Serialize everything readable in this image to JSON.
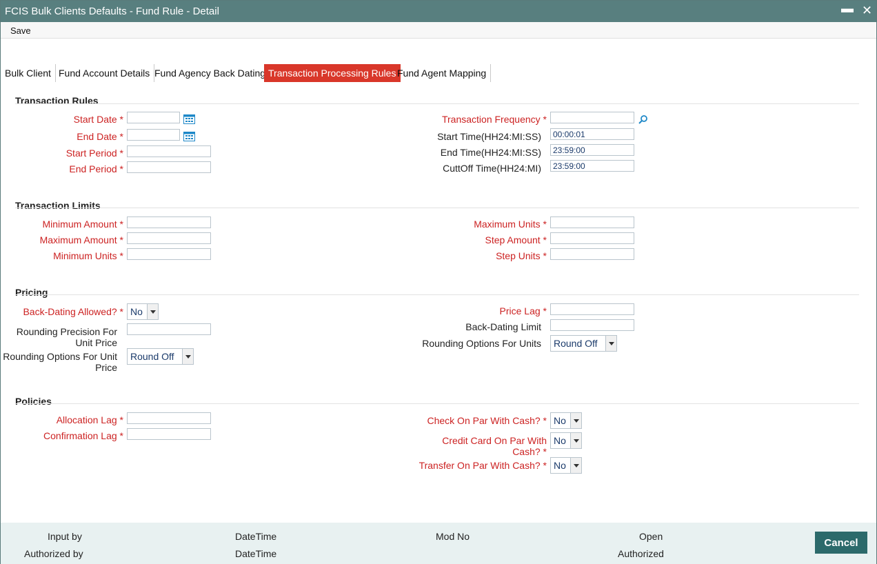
{
  "window": {
    "title": "FCIS Bulk Clients Defaults - Fund Rule - Detail",
    "minimize": "▬",
    "close": "✕"
  },
  "menu": {
    "save": "Save"
  },
  "tabs": [
    {
      "label": "Bulk Client",
      "active": false
    },
    {
      "label": "Fund Account Details",
      "active": false
    },
    {
      "label": "Fund Agency Back Dating",
      "active": false
    },
    {
      "label": "Transaction Processing Rules",
      "active": true
    },
    {
      "label": "Fund Agent Mapping",
      "active": false
    }
  ],
  "transaction_rules": {
    "title": "Transaction Rules",
    "start_date": {
      "label": "Start Date",
      "value": ""
    },
    "end_date": {
      "label": "End Date",
      "value": ""
    },
    "start_period": {
      "label": "Start Period",
      "value": ""
    },
    "end_period": {
      "label": "End Period",
      "value": ""
    },
    "transaction_frequency": {
      "label": "Transaction Frequency",
      "value": ""
    },
    "start_time": {
      "label": "Start Time(HH24:MI:SS)",
      "value": "00:00:01"
    },
    "end_time": {
      "label": "End Time(HH24:MI:SS)",
      "value": "23:59:00"
    },
    "cutoff_time": {
      "label": "CuttOff Time(HH24:MI)",
      "value": "23:59:00"
    }
  },
  "transaction_limits": {
    "title": "Transaction Limits",
    "minimum_amount": {
      "label": "Minimum Amount",
      "value": ""
    },
    "maximum_amount": {
      "label": "Maximum Amount",
      "value": ""
    },
    "minimum_units": {
      "label": "Minimum Units",
      "value": ""
    },
    "maximum_units": {
      "label": "Maximum Units",
      "value": ""
    },
    "step_amount": {
      "label": "Step Amount",
      "value": ""
    },
    "step_units": {
      "label": "Step Units",
      "value": ""
    }
  },
  "pricing": {
    "title": "Pricing",
    "back_dating_allowed": {
      "label": "Back-Dating Allowed?",
      "value": "No"
    },
    "rounding_precision_unit_price": {
      "label": "Rounding Precision For Unit Price",
      "value": ""
    },
    "rounding_options_unit_price": {
      "label": "Rounding Options For Unit Price",
      "value": "Round Off"
    },
    "price_lag": {
      "label": "Price Lag",
      "value": ""
    },
    "back_dating_limit": {
      "label": "Back-Dating Limit",
      "value": ""
    },
    "rounding_options_units": {
      "label": "Rounding Options For Units",
      "value": "Round Off"
    }
  },
  "policies": {
    "title": "Policies",
    "allocation_lag": {
      "label": "Allocation Lag",
      "value": ""
    },
    "confirmation_lag": {
      "label": "Confirmation Lag",
      "value": ""
    },
    "check_on_par": {
      "label": "Check On Par With Cash?",
      "value": "No"
    },
    "credit_card_on_par": {
      "label": "Credit Card On Par With Cash?",
      "value": "No"
    },
    "transfer_on_par": {
      "label": "Transfer On Par With Cash?",
      "value": "No"
    }
  },
  "required_marker": "*",
  "footer": {
    "input_by": "Input by",
    "authorized_by": "Authorized by",
    "datetime_1": "DateTime",
    "datetime_2": "DateTime",
    "mod_no": "Mod No",
    "open": "Open",
    "authorized": "Authorized",
    "cancel": "Cancel"
  },
  "colors": {
    "titlebar": "#587f7f",
    "active_tab": "#d9372a",
    "required_label": "#cc2222",
    "footer_bg": "#e8f1f1",
    "cancel_button": "#2c6a6b"
  }
}
